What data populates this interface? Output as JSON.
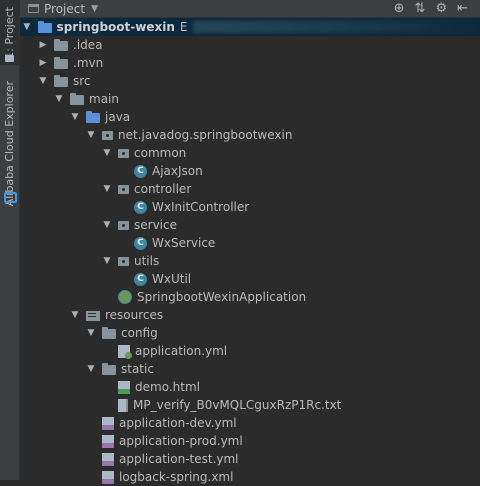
{
  "sidebar": {
    "project_tab": "1: Project",
    "alibaba_tab": "Alibaba Cloud Explorer"
  },
  "toolbar": {
    "title": "Project",
    "icons": [
      "globe-icon",
      "collapse-icon",
      "gear-icon",
      "hide-icon"
    ]
  },
  "tree": [
    {
      "label": "springboot-wexin",
      "suffix": "E",
      "icon": "folder-blue",
      "arrow": "down",
      "depth": 0,
      "bold": true,
      "selected": true
    },
    {
      "label": ".idea",
      "icon": "folder",
      "arrow": "right",
      "depth": 1
    },
    {
      "label": ".mvn",
      "icon": "folder",
      "arrow": "right",
      "depth": 1
    },
    {
      "label": "src",
      "icon": "folder",
      "arrow": "down",
      "depth": 1
    },
    {
      "label": "main",
      "icon": "folder",
      "arrow": "down",
      "depth": 2
    },
    {
      "label": "java",
      "icon": "folder-blue",
      "arrow": "down",
      "depth": 3
    },
    {
      "label": "net.javadog.springbootwexin",
      "icon": "package",
      "arrow": "down",
      "depth": 4
    },
    {
      "label": "common",
      "icon": "package",
      "arrow": "down",
      "depth": 5
    },
    {
      "label": "AjaxJson",
      "icon": "class",
      "arrow": "",
      "depth": 6
    },
    {
      "label": "controller",
      "icon": "package",
      "arrow": "down",
      "depth": 5
    },
    {
      "label": "WxInitController",
      "icon": "class",
      "arrow": "",
      "depth": 6
    },
    {
      "label": "service",
      "icon": "package",
      "arrow": "down",
      "depth": 5
    },
    {
      "label": "WxService",
      "icon": "class",
      "arrow": "",
      "depth": 6
    },
    {
      "label": "utils",
      "icon": "package",
      "arrow": "down",
      "depth": 5
    },
    {
      "label": "WxUtil",
      "icon": "class",
      "arrow": "",
      "depth": 6
    },
    {
      "label": "SpringbootWexinApplication",
      "icon": "spring",
      "arrow": "",
      "depth": 5
    },
    {
      "label": "resources",
      "icon": "resources",
      "arrow": "down",
      "depth": 3
    },
    {
      "label": "config",
      "icon": "folder",
      "arrow": "down",
      "depth": 4
    },
    {
      "label": "application.yml",
      "icon": "yml-green",
      "arrow": "",
      "depth": 5
    },
    {
      "label": "static",
      "icon": "folder",
      "arrow": "down",
      "depth": 4
    },
    {
      "label": "demo.html",
      "icon": "html",
      "arrow": "",
      "depth": 5
    },
    {
      "label": "MP_verify_B0vMQLCguxRzP1Rc.txt",
      "icon": "txt",
      "arrow": "",
      "depth": 5
    },
    {
      "label": "application-dev.yml",
      "icon": "yml",
      "arrow": "",
      "depth": 4
    },
    {
      "label": "application-prod.yml",
      "icon": "yml",
      "arrow": "",
      "depth": 4
    },
    {
      "label": "application-test.yml",
      "icon": "yml",
      "arrow": "",
      "depth": 4
    },
    {
      "label": "logback-spring.xml",
      "icon": "yml",
      "arrow": "",
      "depth": 4
    }
  ]
}
